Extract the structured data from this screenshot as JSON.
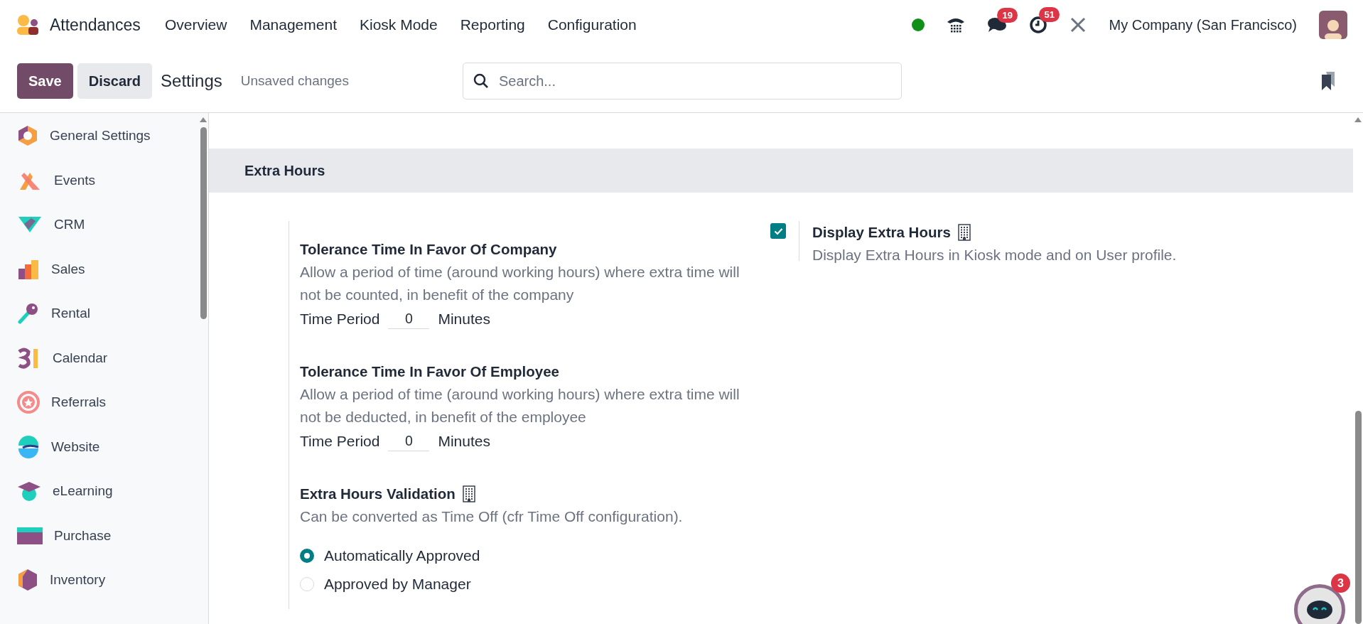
{
  "app": {
    "name": "Attendances"
  },
  "menu": [
    "Overview",
    "Management",
    "Kiosk Mode",
    "Reporting",
    "Configuration"
  ],
  "systray": {
    "chat_badge": "19",
    "activity_badge": "51",
    "company": "My Company (San Francisco)"
  },
  "control_panel": {
    "save": "Save",
    "discard": "Discard",
    "title": "Settings",
    "status": "Unsaved changes",
    "search": {
      "placeholder": "Search..."
    }
  },
  "sidebar": {
    "items": [
      {
        "label": "General Settings"
      },
      {
        "label": "Events"
      },
      {
        "label": "CRM"
      },
      {
        "label": "Sales"
      },
      {
        "label": "Rental"
      },
      {
        "label": "Calendar"
      },
      {
        "label": "Referrals"
      },
      {
        "label": "Website"
      },
      {
        "label": "eLearning"
      },
      {
        "label": "Purchase"
      },
      {
        "label": "Inventory"
      }
    ]
  },
  "section": {
    "title": "Extra Hours"
  },
  "left_settings": [
    {
      "kind": "tolerance",
      "title": "Tolerance Time In Favor Of Company",
      "description": "Allow a period of time (around working hours) where extra time will not be counted, in benefit of the company",
      "field_label": "Time Period",
      "value": "0",
      "unit": "Minutes"
    },
    {
      "kind": "tolerance",
      "title": "Tolerance Time In Favor Of Employee",
      "description": "Allow a period of time (around working hours) where extra time will not be deducted, in benefit of the employee",
      "field_label": "Time Period",
      "value": "0",
      "unit": "Minutes"
    },
    {
      "kind": "radio",
      "title": "Extra Hours Validation",
      "company_icon": true,
      "description": "Can be converted as Time Off (cfr Time Off configuration).",
      "options": [
        {
          "label": "Automatically Approved",
          "selected": true
        },
        {
          "label": "Approved by Manager",
          "selected": false
        }
      ]
    }
  ],
  "right_settings": [
    {
      "kind": "checkbox",
      "title": "Display Extra Hours",
      "company_icon": true,
      "checked": true,
      "description": "Display Extra Hours in Kiosk mode and on User profile."
    }
  ],
  "chat_bubble": {
    "badge": "3"
  }
}
